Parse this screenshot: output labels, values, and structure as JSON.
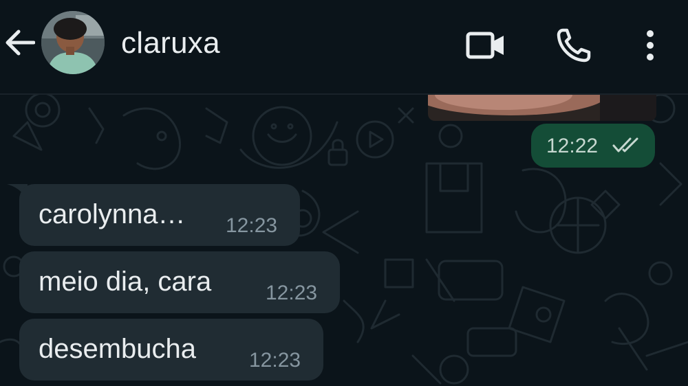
{
  "header": {
    "contact_name": "claruxa",
    "icons": {
      "back": "arrow-left-icon",
      "video": "video-camera-icon",
      "call": "phone-icon",
      "menu": "more-vertical-icon"
    }
  },
  "messages": {
    "outgoing": [
      {
        "time": "12:22",
        "status": "read"
      }
    ],
    "incoming": [
      {
        "text": "carolynna…",
        "time": "12:23"
      },
      {
        "text": "meio dia, cara",
        "time": "12:23"
      },
      {
        "text": "desembucha",
        "time": "12:23"
      }
    ]
  },
  "colors": {
    "background": "#0b141a",
    "incoming_bubble": "#202c33",
    "outgoing_bubble": "#144d37",
    "text_primary": "#e9edef",
    "text_secondary": "#8696a0",
    "read_ticks": "#c7d8d0"
  }
}
